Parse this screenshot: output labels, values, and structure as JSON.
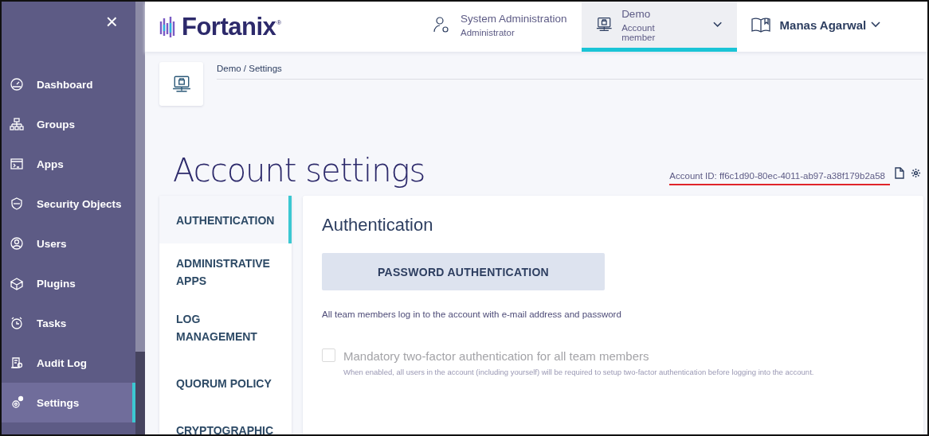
{
  "sidebar": {
    "close": "×",
    "items": [
      {
        "label": "Dashboard",
        "selected": false
      },
      {
        "label": "Groups",
        "selected": false
      },
      {
        "label": "Apps",
        "selected": false
      },
      {
        "label": "Security Objects",
        "selected": false
      },
      {
        "label": "Users",
        "selected": false
      },
      {
        "label": "Plugins",
        "selected": false
      },
      {
        "label": "Tasks",
        "selected": false
      },
      {
        "label": "Audit Log",
        "selected": false
      },
      {
        "label": "Settings",
        "selected": true
      }
    ]
  },
  "header": {
    "logo": "Fortanix",
    "logo_mark": "®",
    "tabs": [
      {
        "kind": "admin",
        "title": "System Administration",
        "subtitle": "Administrator",
        "selected": false
      },
      {
        "kind": "account",
        "title": "Demo",
        "subtitle": "Account member",
        "selected": true
      },
      {
        "kind": "user",
        "title": "Manas Agarwal",
        "selected": false
      }
    ]
  },
  "breadcrumb": "Demo / Settings",
  "page_title": "Account settings",
  "account_id": "Account ID: ff6c1d90-80ec-4011-ab97-a38f179b2a58",
  "settings_nav": [
    {
      "label": "AUTHENTICATION",
      "selected": true
    },
    {
      "label": "ADMINISTRATIVE APPS",
      "selected": false
    },
    {
      "label": "LOG MANAGEMENT",
      "selected": false
    },
    {
      "label": "QUORUM POLICY",
      "selected": false
    },
    {
      "label": "CRYPTOGRAPHIC",
      "selected": false
    }
  ],
  "panel": {
    "title": "Authentication",
    "button": "PASSWORD AUTHENTICATION",
    "description": "All team members log in to the account with e-mail address and password",
    "option": {
      "label": "Mandatory two-factor authentication for all team members",
      "hint": "When enabled, all users in the account (including yourself) will be required to setup two-factor authentication before logging into the account.",
      "checked": false,
      "disabled": true
    }
  }
}
